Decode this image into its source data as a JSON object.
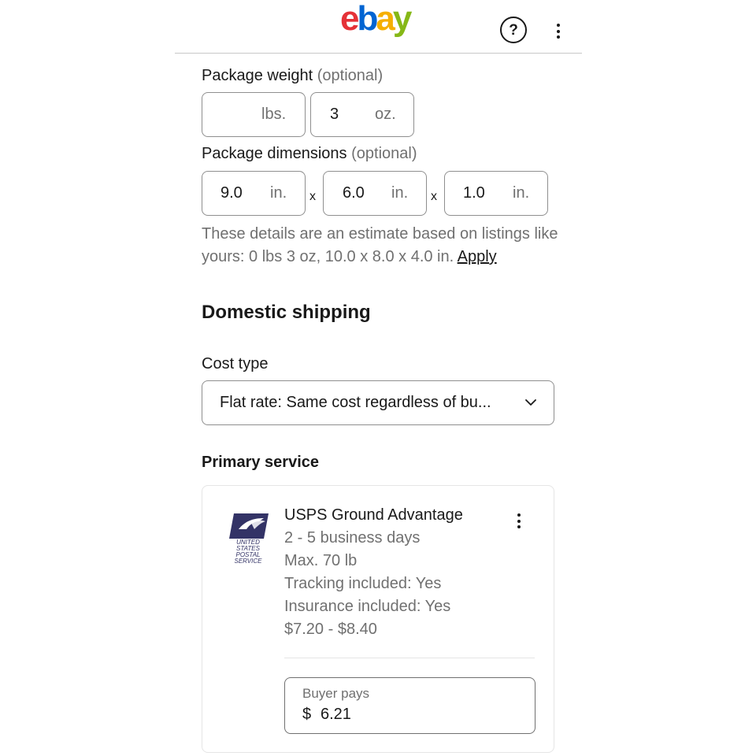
{
  "header": {
    "logo_letters": [
      "e",
      "b",
      "a",
      "y"
    ],
    "logo_colors": [
      "#e53238",
      "#0064d2",
      "#f5af02",
      "#86b817"
    ],
    "help_label": "?"
  },
  "package_weight": {
    "label": "Package weight",
    "optional": "(optional)",
    "lbs_value": "",
    "lbs_unit": "lbs.",
    "oz_value": "3",
    "oz_unit": "oz."
  },
  "package_dimensions": {
    "label": "Package dimensions",
    "optional": "(optional)",
    "length": "9.0",
    "width": "6.0",
    "height": "1.0",
    "unit": "in.",
    "separator": "x"
  },
  "estimate_note": {
    "text": "These details are an estimate based on listings like yours: 0 lbs 3 oz, 10.0 x 8.0 x 4.0 in.",
    "apply_link": "Apply"
  },
  "domestic_shipping": {
    "heading": "Domestic shipping",
    "cost_type_label": "Cost type",
    "cost_type_value": "Flat rate: Same cost regardless of bu..."
  },
  "primary_service": {
    "heading": "Primary service",
    "logo_text": "UNITED STATES POSTAL SERVICE",
    "name": "USPS Ground Advantage",
    "delivery": "2 - 5 business days",
    "max_weight": "Max. 70 lb",
    "tracking": "Tracking included: Yes",
    "insurance": "Insurance included: Yes",
    "price_range": "$7.20 - $8.40",
    "buyer_pays_label": "Buyer pays",
    "currency": "$",
    "buyer_pays_value": "6.21"
  },
  "icons": {
    "help": "help-circle-icon",
    "more": "more-vertical-icon",
    "select": "chevron-down-icon",
    "carrier": "usps-eagle-logo"
  }
}
